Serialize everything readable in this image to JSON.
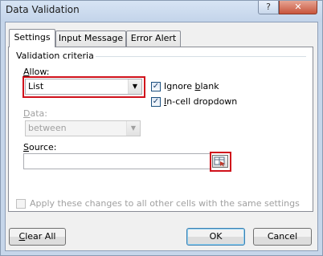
{
  "window": {
    "title": "Data Validation",
    "help_glyph": "?",
    "close_glyph": "✕"
  },
  "tabs": [
    {
      "label": "Settings",
      "active": true
    },
    {
      "label": "Input Message",
      "active": false
    },
    {
      "label": "Error Alert",
      "active": false
    }
  ],
  "settings": {
    "group_label": "Validation criteria",
    "allow_label": "Allow:",
    "allow_value": "List",
    "data_label": "Data:",
    "data_value": "between",
    "ignore_blank_label": "Ignore blank",
    "ignore_blank_checked": true,
    "incell_dropdown_label": "In-cell dropdown",
    "incell_dropdown_checked": true,
    "source_label": "Source:",
    "source_value": "",
    "apply_all_label": "Apply these changes to all other cells with the same settings",
    "apply_all_checked": false
  },
  "buttons": {
    "clear_all": "Clear All",
    "ok": "OK",
    "cancel": "Cancel"
  },
  "colors": {
    "highlight": "#d0111b",
    "frame": "#c6d6ea"
  }
}
